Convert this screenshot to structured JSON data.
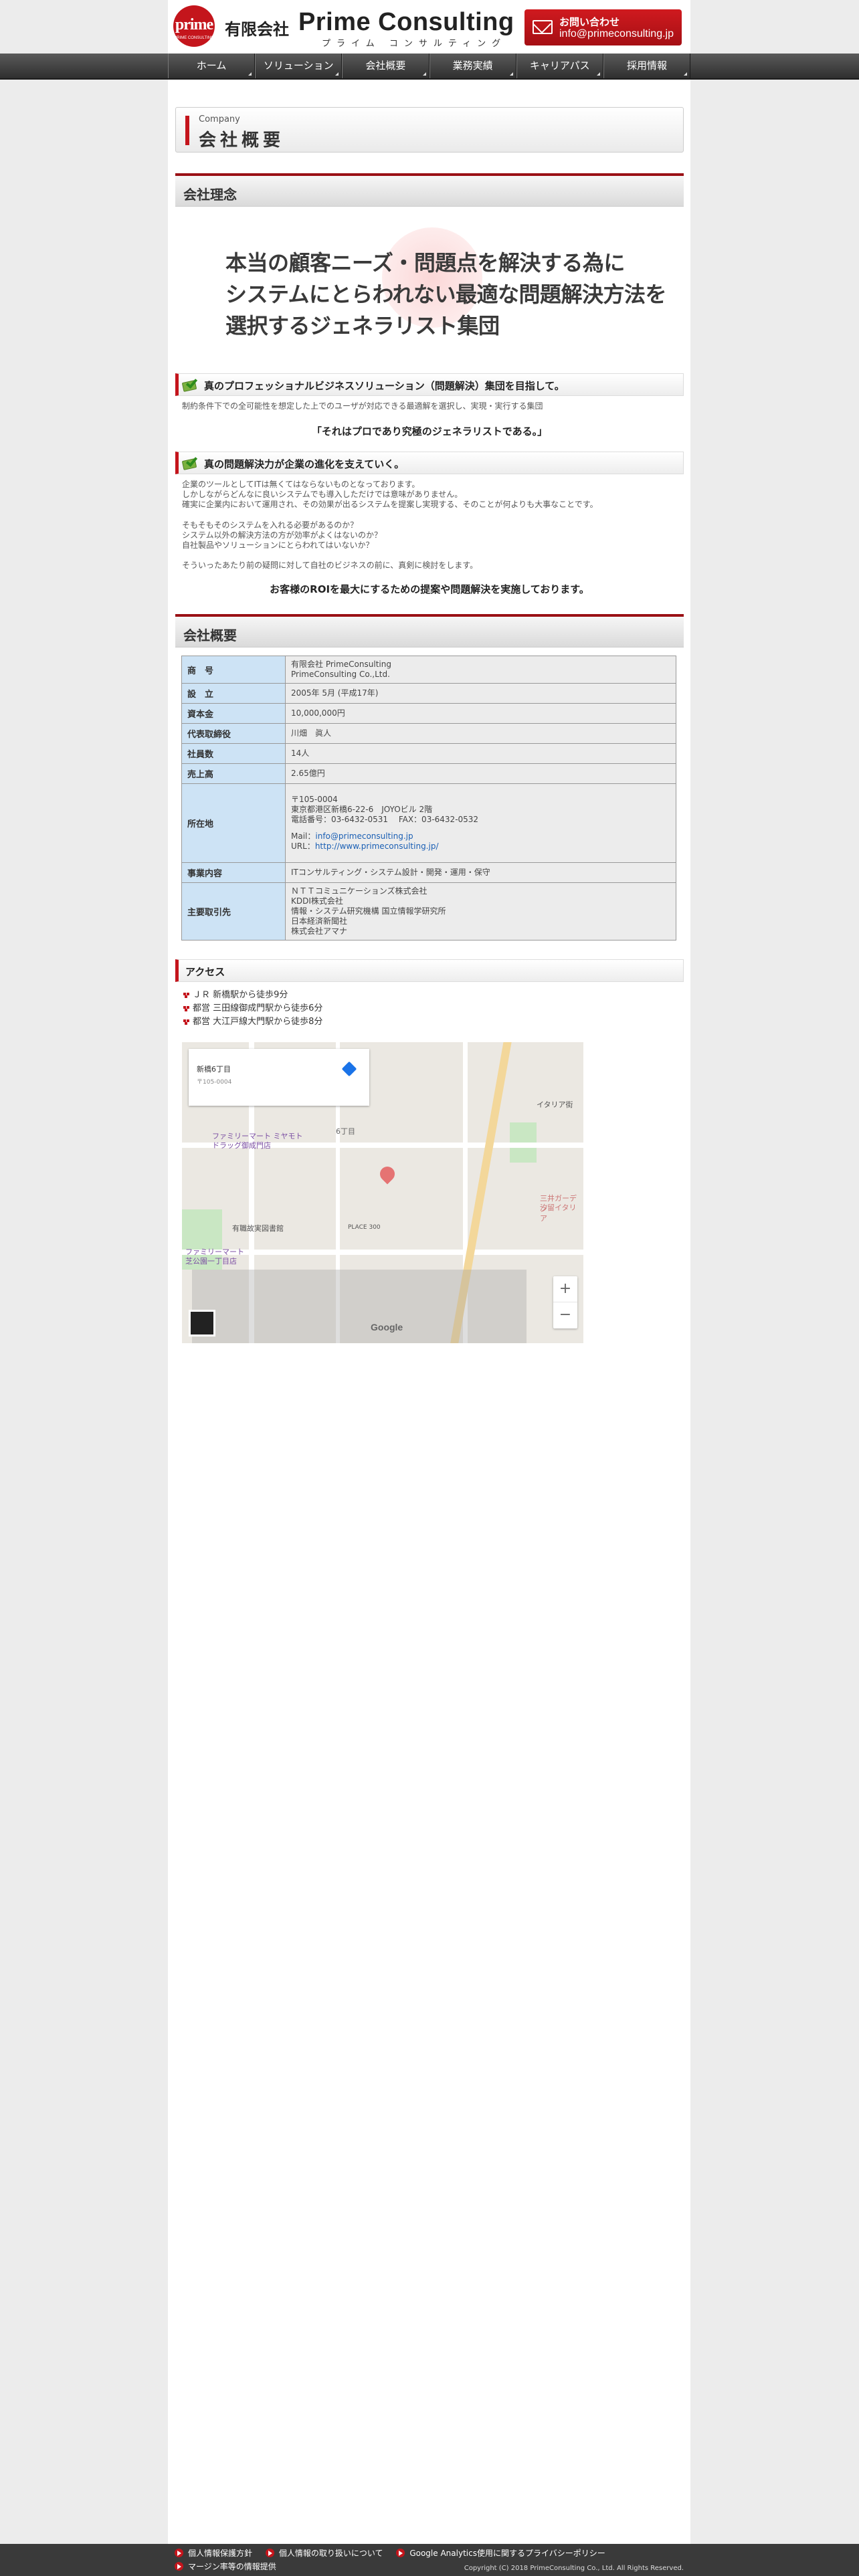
{
  "header": {
    "logo_text": "prime",
    "logo_sub": "PRIME CONSULTING",
    "company_type": "有限会社",
    "company_name": "Prime Consulting",
    "company_kana": "プライム コンサルティング",
    "contact_label": "お問い合わせ",
    "contact_email": "info@primeconsulting.jp"
  },
  "nav": [
    "ホーム",
    "ソリューション",
    "会社概要",
    "業務実績",
    "キャリアパス",
    "採用情報"
  ],
  "page_title": {
    "en": "Company",
    "jp": "会社概要"
  },
  "philosophy": {
    "heading": "会社理念",
    "motto_lines": [
      "本当の顧客ニーズ・問題点を解決する為に",
      "システムにとらわれない最適な問題解決方法を",
      "選択するジェネラリスト集団"
    ]
  },
  "sub1": {
    "heading": "真のプロフェッショナルビジネスソリューション（問題解決）集団を目指して。",
    "text": "制約条件下での全可能性を想定した上でのユーザが対応できる最適解を選択し、実現・実行する集団",
    "quote": "「それはプロであり究極のジェネラリストである。」"
  },
  "sub2": {
    "heading": "真の問題解決力が企業の進化を支えていく。",
    "para1": [
      "企業のツールとしてITは無くてはならないものとなっております。",
      "しかしながらどんなに良いシステムでも導入しただけでは意味がありません。",
      "確実に企業内において運用され、その効果が出るシステムを提案し実現する、そのことが何よりも大事なことです。"
    ],
    "para2": [
      "そもそもそのシステムを入れる必要があるのか？",
      "システム以外の解決方法の方が効率がよくはないのか？",
      "自社製品やソリューションにとらわれてはいないか？"
    ],
    "para3": "そういったあたり前の疑問に対して自社のビジネスの前に、真剣に検討をします。",
    "closing": "お客様のROIを最大にするための提案や問題解決を実施しております。"
  },
  "overview": {
    "heading": "会社概要",
    "rows": [
      {
        "key": "商　号",
        "lines": [
          "有限会社 PrimeConsulting",
          "PrimeConsulting Co.,Ltd."
        ]
      },
      {
        "key": "設　立",
        "lines": [
          "2005年 5月 (平成17年)"
        ]
      },
      {
        "key": "資本金",
        "lines": [
          "10,000,000円"
        ]
      },
      {
        "key": "代表取締役",
        "lines": [
          "川畑　眞人"
        ]
      },
      {
        "key": "社員数",
        "lines": [
          "14人"
        ]
      },
      {
        "key": "売上高",
        "lines": [
          "2.65億円"
        ]
      }
    ],
    "address": {
      "key": "所在地",
      "postal": "〒105-0004",
      "line1": "東京都港区新橋6-22-6　JOYOビル 2階",
      "phone": "電話番号：03-6432-0531　 FAX：03-6432-0532",
      "mail_label": "Mail：",
      "mail": "info@primeconsulting.jp",
      "url_label": "URL：",
      "url": "http://www.primeconsulting.jp/"
    },
    "business": {
      "key": "事業内容",
      "value": "ITコンサルティング・システム設計・開発・運用・保守"
    },
    "clients": {
      "key": "主要取引先",
      "lines": [
        "ＮＴＴコミュニケーションズ株式会社",
        "KDDI株式会社",
        "情報・システム研究機構 国立情報学研究所",
        "日本経済新聞社",
        "株式会社アマナ"
      ]
    }
  },
  "access": {
    "heading": "アクセス",
    "items": [
      "ＪＲ 新橋駅から徒歩9分",
      "都営 三田線御成門駅から徒歩6分",
      "都営 大江戸線大門駅から徒歩8分"
    ]
  },
  "map": {
    "place_name": "新橋6丁目",
    "card_address": "〒105-0004",
    "zoom_in": "+",
    "zoom_out": "−",
    "google": "Google",
    "labels": [
      "ファミリーマート ミヤモト",
      "ドラッグ御成門店",
      "有職故実図書館",
      "PLACE 300",
      "ファミリーマート",
      "芝公園一丁目店",
      "イタリア街",
      "三井ガーデン",
      "汐留イタリア",
      "6丁目"
    ]
  },
  "footer": {
    "links": [
      "個人情報保護方針",
      "個人情報の取り扱いについて",
      "Google Analytics使用に関するプライバシーポリシー",
      "マージン率等の情報提供"
    ],
    "copyright": "Copyright (C) 2018 PrimeConsulting Co., Ltd. All Rights Reserved."
  }
}
